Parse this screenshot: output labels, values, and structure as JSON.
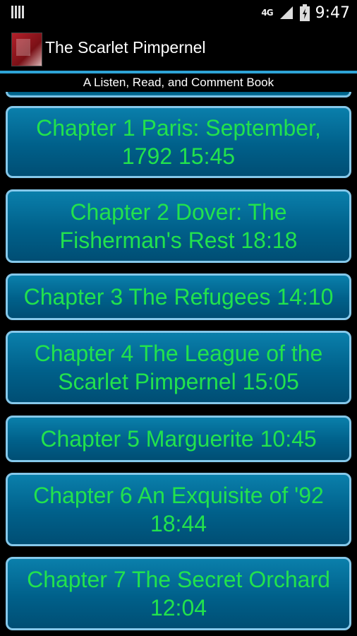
{
  "status_bar": {
    "network": "4G",
    "time": "9:47"
  },
  "app": {
    "title": "The Scarlet Pimpernel",
    "subtitle": "A Listen, Read, and Comment Book"
  },
  "chapters": [
    {
      "label": "Chapter 1 Paris: September, 1792 15:45"
    },
    {
      "label": "Chapter 2 Dover: The Fisherman's Rest 18:18"
    },
    {
      "label": "Chapter 3 The Refugees 14:10"
    },
    {
      "label": "Chapter 4 The League of the Scarlet Pimpernel 15:05"
    },
    {
      "label": "Chapter 5 Marguerite 10:45"
    },
    {
      "label": "Chapter 6 An Exquisite of '92 18:44"
    },
    {
      "label": "Chapter 7 The Secret Orchard 12:04"
    }
  ],
  "colors": {
    "chapter_text": "#22e24d",
    "chapter_border": "#85c8ea",
    "chapter_bg": "#00608a",
    "accent_line": "#2ea3d6"
  }
}
